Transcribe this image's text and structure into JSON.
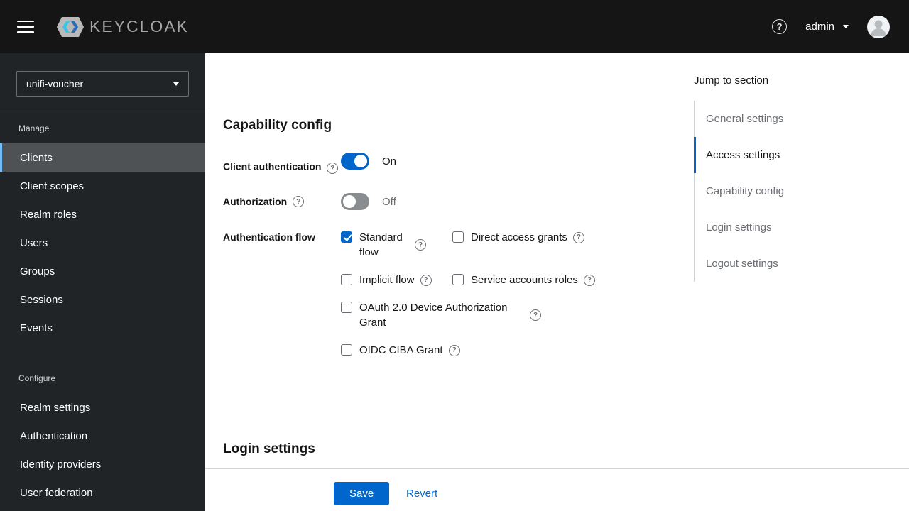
{
  "masthead": {
    "brand": "KEYCLOAK",
    "user_menu": "admin"
  },
  "sidebar": {
    "realm_selector": {
      "value": "unifi-voucher"
    },
    "groups": [
      {
        "label": "Manage",
        "items": [
          {
            "label": "Clients",
            "active": true
          },
          {
            "label": "Client scopes",
            "active": false
          },
          {
            "label": "Realm roles",
            "active": false
          },
          {
            "label": "Users",
            "active": false
          },
          {
            "label": "Groups",
            "active": false
          },
          {
            "label": "Sessions",
            "active": false
          },
          {
            "label": "Events",
            "active": false
          }
        ]
      },
      {
        "label": "Configure",
        "items": [
          {
            "label": "Realm settings",
            "active": false
          },
          {
            "label": "Authentication",
            "active": false
          },
          {
            "label": "Identity providers",
            "active": false
          },
          {
            "label": "User federation",
            "active": false
          }
        ]
      }
    ]
  },
  "content": {
    "capability_section": {
      "title": "Capability config"
    },
    "client_authentication": {
      "label": "Client authentication",
      "state": "On",
      "enabled": true
    },
    "authorization": {
      "label": "Authorization",
      "state": "Off",
      "enabled": false
    },
    "authentication_flow": {
      "label": "Authentication flow",
      "options": [
        {
          "label": "Standard flow",
          "checked": true
        },
        {
          "label": "Direct access grants",
          "checked": false
        },
        {
          "label": "Implicit flow",
          "checked": false
        },
        {
          "label": "Service accounts roles",
          "checked": false
        },
        {
          "label": "OAuth 2.0 Device Authorization Grant",
          "checked": false
        },
        {
          "label": "OIDC CIBA Grant",
          "checked": false
        }
      ]
    },
    "login_section": {
      "title": "Login settings"
    },
    "actions": {
      "save": "Save",
      "revert": "Revert"
    }
  },
  "jump_nav": {
    "title": "Jump to section",
    "items": [
      {
        "label": "General settings",
        "active": false
      },
      {
        "label": "Access settings",
        "active": true
      },
      {
        "label": "Capability config",
        "active": false
      },
      {
        "label": "Login settings",
        "active": false
      },
      {
        "label": "Logout settings",
        "active": false
      }
    ]
  },
  "colors": {
    "primary_blue": "#0066cc",
    "masthead_bg": "#151515",
    "sidebar_bg": "#212427",
    "sidebar_current_bg": "#4f5255",
    "sidebar_current_accent": "#73bcf7",
    "toggle_off_gray": "#8a8d90",
    "muted_text": "#6a6e73",
    "divider_border": "#d2d2d2",
    "logo_cyan": "#33c6e9",
    "logo_blue": "#2a6fb5"
  }
}
